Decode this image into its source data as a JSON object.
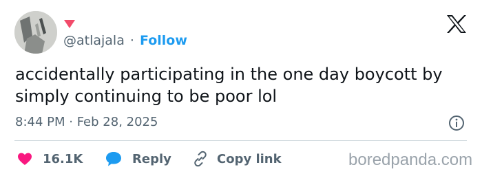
{
  "author": {
    "handle": "@atlajala",
    "separator": "·",
    "follow_label": "Follow"
  },
  "tweet": {
    "text": "accidentally participating in the one day boycott by simply continuing to be poor lol",
    "timestamp": "8:44 PM · Feb 28, 2025"
  },
  "actions": {
    "likes": "16.1K",
    "reply_label": "Reply",
    "copy_link_label": "Copy link"
  },
  "watermark": "boredpanda.com",
  "colors": {
    "like": "#f91880",
    "reply": "#1d9bf0",
    "follow": "#1d9bf0",
    "marker": "#f24b6a"
  },
  "icons": [
    "x-logo-icon",
    "info-icon",
    "heart-icon",
    "reply-bubble-icon",
    "link-icon"
  ]
}
